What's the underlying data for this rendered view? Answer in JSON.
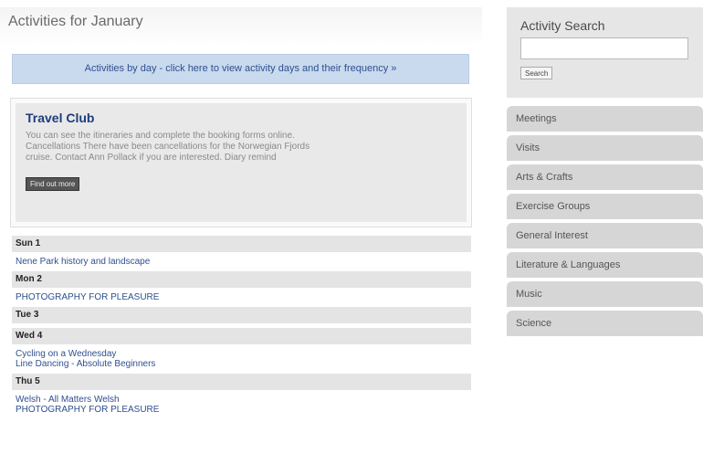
{
  "header": {
    "title": "Activities for January"
  },
  "banner": {
    "label": "Activities by day - click here to view activity days and their frequency »"
  },
  "featured": {
    "title": "Travel Club",
    "description": "You can see the itineraries and complete the booking forms online. Cancellations There have been cancellations for the Norwegian Fjords  cruise. Contact Ann Pollack if you are interested. Diary remind",
    "button_label": "Find out more"
  },
  "schedule": [
    {
      "day": "Sun 1",
      "activities": [
        "Nene Park history and landscape"
      ]
    },
    {
      "day": "Mon 2",
      "activities": [
        "PHOTOGRAPHY FOR PLEASURE"
      ]
    },
    {
      "day": "Tue 3",
      "activities": []
    },
    {
      "day": "Wed 4",
      "activities": [
        "Cycling on a Wednesday",
        "Line Dancing - Absolute Beginners"
      ]
    },
    {
      "day": "Thu 5",
      "activities": [
        "Welsh - All Matters Welsh",
        "PHOTOGRAPHY FOR PLEASURE"
      ]
    }
  ],
  "search": {
    "title": "Activity Search",
    "value": "",
    "button_label": "Search"
  },
  "categories": [
    "Meetings",
    "Visits",
    "Arts & Crafts",
    "Exercise Groups",
    "General Interest",
    "Literature & Languages",
    "Music",
    "Science"
  ]
}
